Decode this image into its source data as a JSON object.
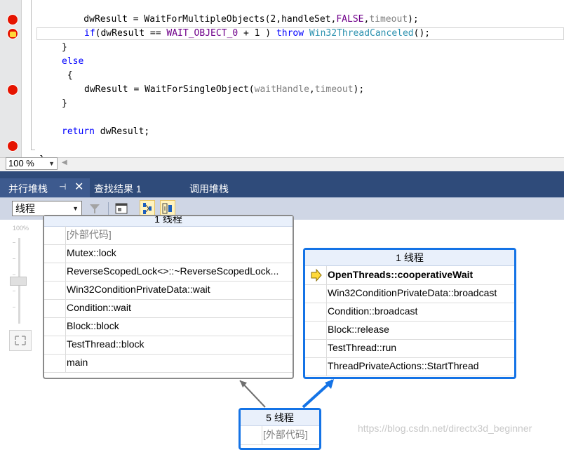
{
  "editor": {
    "lines": [
      {
        "parts": [
          {
            "t": "    dwResult = WaitForMultipleObjects(2,handleSet,",
            "c": ""
          },
          {
            "t": "FALSE",
            "c": "mac"
          },
          {
            "t": ",",
            "c": ""
          },
          {
            "t": "timeout",
            "c": "prm"
          },
          {
            "t": ");",
            "c": ""
          }
        ],
        "indent": 2
      },
      {
        "parts": [
          {
            "t": "if",
            "c": "kw"
          },
          {
            "t": "(dwResult == ",
            "c": ""
          },
          {
            "t": "WAIT_OBJECT_0",
            "c": "mac"
          },
          {
            "t": " + 1 ) ",
            "c": ""
          },
          {
            "t": "throw",
            "c": "kw"
          },
          {
            "t": " ",
            "c": ""
          },
          {
            "t": "Win32ThreadCanceled",
            "c": "typ"
          },
          {
            "t": "();",
            "c": ""
          }
        ],
        "indent": 2
      },
      {
        "parts": [
          {
            "t": "}",
            "c": ""
          }
        ],
        "indent": 1
      },
      {
        "parts": [
          {
            "t": "else",
            "c": "kw"
          }
        ],
        "indent": 1
      },
      {
        "parts": [
          {
            "t": " {",
            "c": ""
          }
        ],
        "indent": 1
      },
      {
        "parts": [
          {
            "t": "dwResult = WaitForSingleObject(",
            "c": ""
          },
          {
            "t": "waitHandle",
            "c": "prm"
          },
          {
            "t": ",",
            "c": ""
          },
          {
            "t": "timeout",
            "c": "prm"
          },
          {
            "t": ");",
            "c": ""
          }
        ],
        "indent": 2
      },
      {
        "parts": [
          {
            "t": "}",
            "c": ""
          }
        ],
        "indent": 1
      },
      {
        "parts": [],
        "indent": 1
      },
      {
        "parts": [
          {
            "t": "return",
            "c": "kw"
          },
          {
            "t": " dwResult;",
            "c": ""
          }
        ],
        "indent": 1
      },
      {
        "parts": [],
        "indent": 1
      },
      {
        "parts": [
          {
            "t": "}",
            "c": ""
          }
        ],
        "indent": 0
      }
    ],
    "zoom": "100 %"
  },
  "tabs": {
    "parallel_stacks": "并行堆栈",
    "find_results": "查找结果 1",
    "call_stack": "调用堆栈"
  },
  "toolbar": {
    "view_select": "线程"
  },
  "canvas": {
    "zoom_label": "100%",
    "left_box": {
      "title": "1 线程",
      "frames": [
        "[外部代码]",
        "Mutex::lock",
        "ReverseScopedLock<>::~ReverseScopedLock...",
        "Win32ConditionPrivateData::wait",
        "Condition::wait",
        "Block::block",
        "TestThread::block",
        "main"
      ]
    },
    "right_box": {
      "title": "1 线程",
      "frames": [
        "OpenThreads::cooperativeWait",
        "Win32ConditionPrivateData::broadcast",
        "Condition::broadcast",
        "Block::release",
        "TestThread::run",
        "ThreadPrivateActions::StartThread"
      ]
    },
    "bottom_box": {
      "title": "5 线程",
      "frames": [
        "[外部代码]"
      ]
    }
  },
  "watermark": "https://blog.csdn.net/directx3d_beginner",
  "colors": {
    "accent": "#1473e6",
    "breakpoint": "#e51400",
    "tab_bg": "#2f4b7a"
  }
}
